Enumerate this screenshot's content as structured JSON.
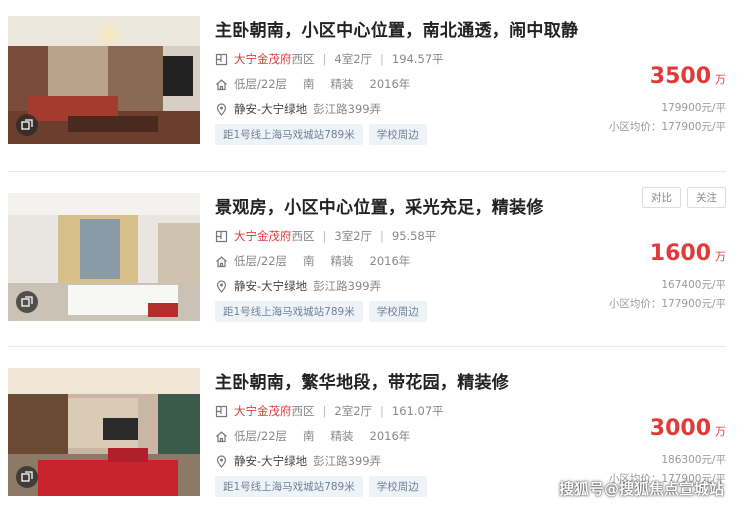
{
  "listings": [
    {
      "title": "主卧朝南，小区中心位置，南北通透，闹中取静",
      "community": "大宁金茂府",
      "district": "西区",
      "layout": "4室2厅",
      "area": "194.57平",
      "floor": "低层/22层",
      "orientation": "南",
      "decoration": "精装",
      "year": "2016年",
      "location_area": "静安-大宁绿地",
      "address": "彭江路399弄",
      "tags": [
        "距1号线上海马戏城站789米",
        "学校周边"
      ],
      "price": "3500",
      "price_unit": "万",
      "unit_price": "179900元/平",
      "avg_price": "小区均价：177900元/平"
    },
    {
      "title": "景观房，小区中心位置，采光充足，精装修",
      "community": "大宁金茂府",
      "district": "西区",
      "layout": "3室2厅",
      "area": "95.58平",
      "floor": "低层/22层",
      "orientation": "南",
      "decoration": "精装",
      "year": "2016年",
      "location_area": "静安-大宁绿地",
      "address": "彭江路399弄",
      "tags": [
        "距1号线上海马戏城站789米",
        "学校周边"
      ],
      "price": "1600",
      "price_unit": "万",
      "unit_price": "167400元/平",
      "avg_price": "小区均价：177900元/平",
      "actions": [
        "对比",
        "关注"
      ]
    },
    {
      "title": "主卧朝南，繁华地段，带花园，精装修",
      "community": "大宁金茂府",
      "district": "西区",
      "layout": "2室2厅",
      "area": "161.07平",
      "floor": "低层/22层",
      "orientation": "南",
      "decoration": "精装",
      "year": "2016年",
      "location_area": "静安-大宁绿地",
      "address": "彭江路399弄",
      "tags": [
        "距1号线上海马戏城站789米",
        "学校周边"
      ],
      "price": "3000",
      "price_unit": "万",
      "unit_price": "186300元/平",
      "avg_price": "小区均价：177900元/平"
    }
  ],
  "watermark": "搜狐号@搜狐焦点宣城站",
  "icons": {
    "layout": "floorplan-icon",
    "floor": "house-icon",
    "location": "location-pin-icon",
    "gallery": "gallery-icon"
  },
  "colors": {
    "price": "#e03a3a",
    "tag_bg": "#eef3f8",
    "tag_text": "#6f8296"
  }
}
